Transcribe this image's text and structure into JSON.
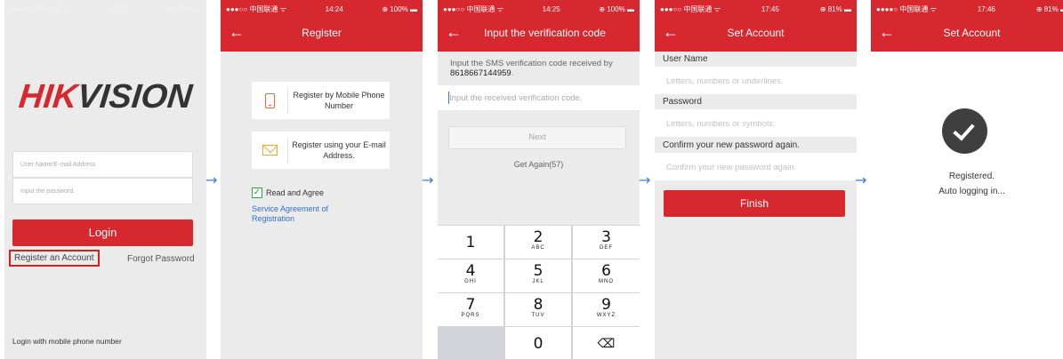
{
  "screens": {
    "login": {
      "status": {
        "carrier": "●●●○○ 中国联通 ᯤ",
        "time": "14:22",
        "battery": "⊕ 100% ▬"
      },
      "logo_red": "HIK",
      "logo_dark": "VISION",
      "username_placeholder": "User Name/E-mail Address",
      "password_placeholder": "Input the password.",
      "login_label": "Login",
      "register_label": "Register an Account",
      "forgot_label": "Forgot Password",
      "mobile_login_label": "Login with mobile phone number"
    },
    "register": {
      "status": {
        "carrier": "●●●○○ 中国联通 ᯤ",
        "time": "14:24",
        "battery": "⊕ 100% ▬"
      },
      "title": "Register",
      "option_mobile": "Register by Mobile Phone Number",
      "option_email": "Register using your E-mail Address.",
      "agree_label": "Read and Agree",
      "agreement_link": "Service Agreement of Registration"
    },
    "verify": {
      "status": {
        "carrier": "●●●○○ 中国联通 ᯤ",
        "time": "14:25",
        "battery": "⊕ 100% ▬"
      },
      "title": "Input the verification code",
      "info_prefix": "Input the SMS verification code received by ",
      "phone_number": "8618667144959",
      "info_suffix": ".",
      "code_placeholder": "Input the received verification code.",
      "next_label": "Next",
      "get_again_label": "Get Again(57)",
      "keypad": [
        {
          "n": "1",
          "l": ""
        },
        {
          "n": "2",
          "l": "ABC"
        },
        {
          "n": "3",
          "l": "DEF"
        },
        {
          "n": "4",
          "l": "GHI"
        },
        {
          "n": "5",
          "l": "JKL"
        },
        {
          "n": "6",
          "l": "MNO"
        },
        {
          "n": "7",
          "l": "PQRS"
        },
        {
          "n": "8",
          "l": "TUV"
        },
        {
          "n": "9",
          "l": "WXYZ"
        },
        {
          "n": "",
          "l": ""
        },
        {
          "n": "0",
          "l": ""
        },
        {
          "n": "⌫",
          "l": ""
        }
      ]
    },
    "set_account": {
      "status": {
        "carrier": "●●●○○ 中国联通 ᯤ",
        "time": "17:45",
        "battery": "⊕ 81% ▬"
      },
      "title": "Set Account",
      "username_label": "User Name",
      "username_placeholder": "Letters, numbers or underlines.",
      "password_label": "Password",
      "password_placeholder": "Letters, numbers or symbols.",
      "confirm_label": "Confirm your new password again.",
      "confirm_placeholder": "Confirm your new password again.",
      "finish_label": "Finish"
    },
    "registered": {
      "status": {
        "carrier": "●●●●○ 中国联通 ᯤ",
        "time": "17:46",
        "battery": "⊕ 81% ▬"
      },
      "title": "Set Account",
      "line1": "Registered.",
      "line2": "Auto logging in..."
    }
  },
  "flow_arrow": "→",
  "colors": {
    "brand_red": "#d8282f",
    "link_blue": "#2f6fd4",
    "highlight_box": "#d82020",
    "check_green": "#2aa64b"
  }
}
